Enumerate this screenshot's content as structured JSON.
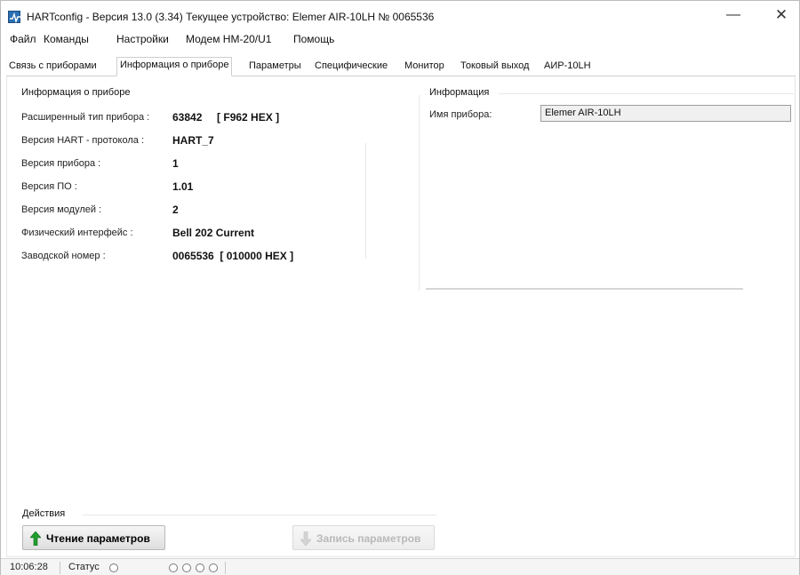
{
  "window": {
    "title": "HARTconfig - Версия 13.0 (3.34) Текущее устройство: Elemer AIR-10LH № 0065536",
    "minimize_glyph": "—",
    "close_glyph": "✕"
  },
  "menu": {
    "items": [
      "Файл",
      "Команды",
      "Настройки",
      "Модем HM-20/U1",
      "Помощь"
    ]
  },
  "tabs": {
    "items": [
      "Связь с приборами",
      "Информация о приборе",
      "Параметры",
      "Специфические",
      "Монитор",
      "Токовый выход",
      "АИР-10LH"
    ],
    "active": "Информация о приборе"
  },
  "device_info": {
    "group_title": "Информация о приборе",
    "rows": [
      {
        "label": "Расширенный тип прибора :",
        "value": "63842     [ F962 HEX ]"
      },
      {
        "label": "Версия HART - протокола :",
        "value": "HART_7"
      },
      {
        "label": "Версия прибора :",
        "value": "1"
      },
      {
        "label": "Версия ПО :",
        "value": "1.01"
      },
      {
        "label": "Версия модулей :",
        "value": "2"
      },
      {
        "label": "Физический интерфейс :",
        "value": "Bell 202 Current"
      },
      {
        "label": "Заводской номер :",
        "value": "0065536  [ 010000 HEX ]"
      }
    ]
  },
  "info_panel": {
    "group_title": "Информация",
    "name_label": "Имя прибора:",
    "name_value": "Elemer AIR-10LH"
  },
  "actions": {
    "group_title": "Действия",
    "read_label": "Чтение параметров",
    "write_label": "Запись параметров",
    "read_enabled": true,
    "write_enabled": false
  },
  "status": {
    "time": "10:06:28",
    "label": "Статус",
    "indicator_count": 4
  },
  "colors": {
    "read_arrow": "#1e9e2e",
    "write_arrow": "#c9c9c9",
    "app_icon": "#2b6fb3"
  }
}
